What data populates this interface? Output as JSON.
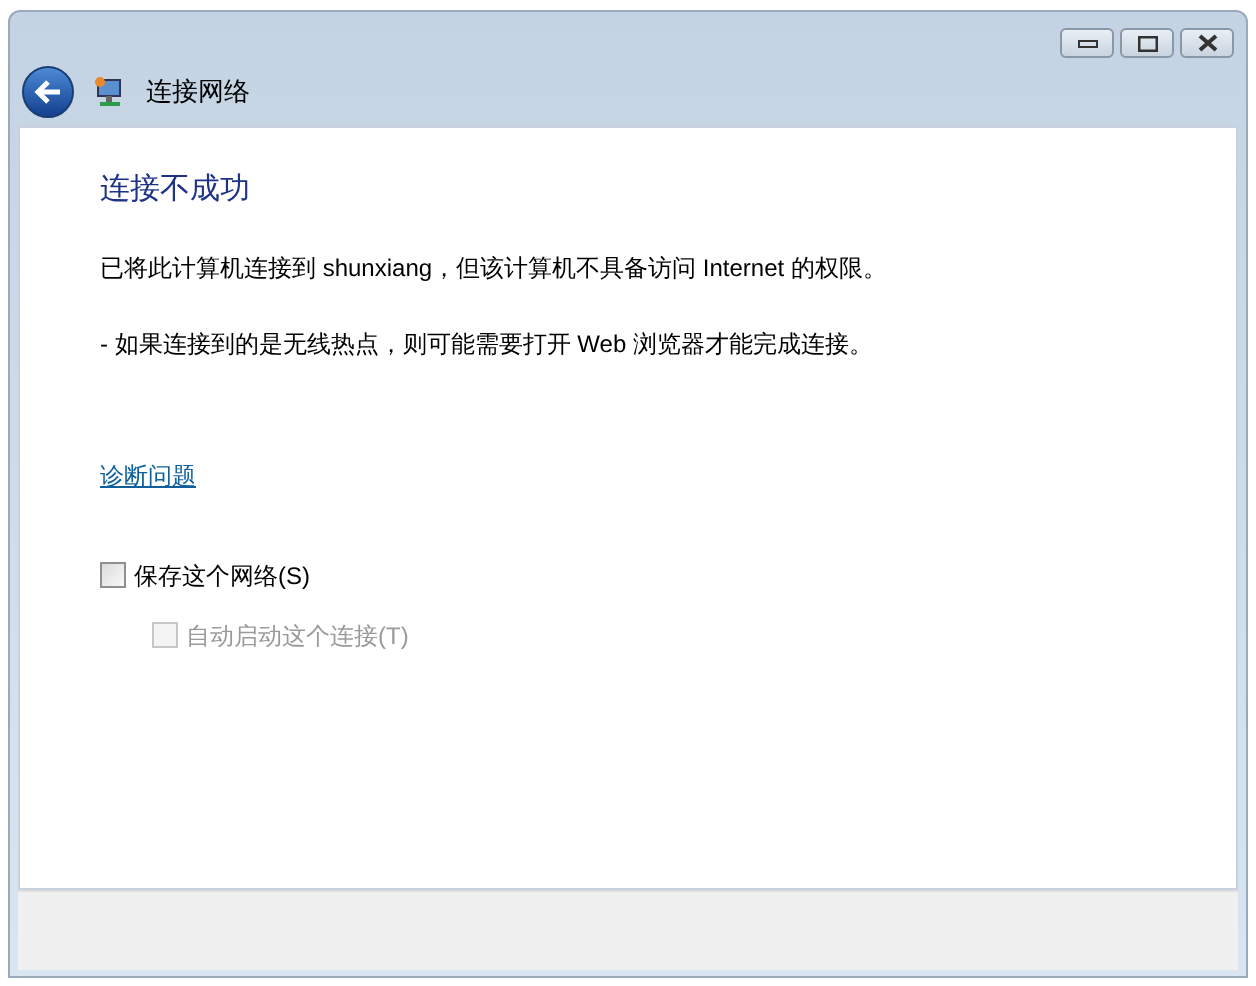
{
  "window": {
    "title": "连接网络"
  },
  "heading": "连接不成功",
  "message": "已将此计算机连接到 shunxiang，但该计算机不具备访问 Internet 的权限。",
  "note": "- 如果连接到的是无线热点，则可能需要打开 Web 浏览器才能完成连接。",
  "link": "诊断问题",
  "options": [
    {
      "label": "保存这个网络(S)",
      "checked": false,
      "disabled": false
    },
    {
      "label": "自动启动这个连接(T)",
      "checked": false,
      "disabled": true
    }
  ]
}
